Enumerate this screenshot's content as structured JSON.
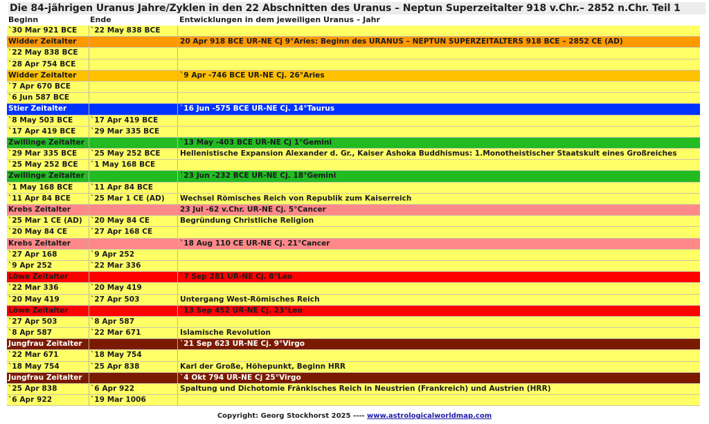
{
  "title": "Die 84-jährigen Uranus Jahre/Zyklen in den 22 Abschnitten des Uranus – Neptun Superzeitalter 918 v.Chr.– 2852 n.Chr.   Teil 1",
  "headers": {
    "begin": "Beginn",
    "end": "Ende",
    "dev": "Entwicklungen in dem jeweiligen Uranus – Jahr"
  },
  "colors": {
    "yellow": "#ffff66",
    "orange": "#ff9900",
    "gold": "#ffc000",
    "blue": "#0033ff",
    "green": "#22bb22",
    "pink": "#ff8888",
    "red": "#ff0000",
    "brown": "#7a1a00"
  },
  "rows": [
    {
      "c1": "`30 Mar 921 BCE",
      "c2": "`22 May 838 BCE",
      "c3": "",
      "bg": "#ffff66",
      "fg": "#1b1b1b"
    },
    {
      "c1": "Widder Zeitalter",
      "c2": "",
      "c3": "20 Apr 918 BCE UR-NE Cj 9°Aries:  Beginn des URANUS – NEPTUN SUPERZEITALTERS   918 BCE – 2852 CE (AD)",
      "bg": "#ff9900",
      "fg": "#1b1b1b"
    },
    {
      "c1": "`22 May 838 BCE",
      "c2": "",
      "c3": "",
      "bg": "#ffff66",
      "fg": "#1b1b1b"
    },
    {
      "c1": "`28 Apr 754 BCE",
      "c2": "",
      "c3": "",
      "bg": "#ffff66",
      "fg": "#1b1b1b"
    },
    {
      "c1": "Widder Zeitalter",
      "c2": "",
      "c3": "`9 Apr -746 BCE      UR-NE Cj. 26°Aries",
      "bg": "#ffc000",
      "fg": "#1b1b1b"
    },
    {
      "c1": "`7 Apr 670 BCE",
      "c2": "",
      "c3": "",
      "bg": "#ffff66",
      "fg": "#1b1b1b"
    },
    {
      "c1": "`6 Jun 587 BCE",
      "c2": "",
      "c3": "",
      "bg": "#ffff66",
      "fg": "#1b1b1b"
    },
    {
      "c1": "Stier Zeitalter",
      "c2": "",
      "c3": "`16 Jun  -575 BCE     UR-NE Cj. 14°Taurus",
      "bg": "#0033ff",
      "fg": "#ffffff"
    },
    {
      "c1": "`8 May 503 BCE",
      "c2": "`17 Apr 419 BCE",
      "c3": "",
      "bg": "#ffff66",
      "fg": "#1b1b1b"
    },
    {
      "c1": "`17 Apr 419 BCE",
      "c2": "`29 Mar 335 BCE",
      "c3": "",
      "bg": "#ffff66",
      "fg": "#1b1b1b"
    },
    {
      "c1": "Zwillinge Zeitalter",
      "c2": "",
      "c3": "`13 May -403 BCE     UR-NE Cj   1°Gemini",
      "bg": "#22bb22",
      "fg": "#1b1b1b"
    },
    {
      "c1": "`29 Mar 335 BCE",
      "c2": "`25 May 252 BCE",
      "c3": "Hellenistische Expansion Alexander d. Gr., Kaiser Ashoka Buddhismus: 1.Monotheistischer Staatskult eines Großreiches",
      "bg": "#ffff66",
      "fg": "#1b1b1b"
    },
    {
      "c1": "`25 May 252 BCE",
      "c2": "`1 May 168 BCE",
      "c3": "",
      "bg": "#ffff66",
      "fg": "#1b1b1b"
    },
    {
      "c1": "Zwillinge Zeitalter",
      "c2": "",
      "c3": "`23 Jun -232 BCE     UR-NE Cj. 18°Gemini",
      "bg": "#22bb22",
      "fg": "#1b1b1b"
    },
    {
      "c1": "`1 May 168 BCE",
      "c2": "`11 Apr 84 BCE",
      "c3": "",
      "bg": "#ffff66",
      "fg": "#1b1b1b"
    },
    {
      "c1": "`11 Apr 84 BCE",
      "c2": "`25 Mar 1 CE (AD)",
      "c3": "Wechsel Römisches Reich von Republik zum Kaiserreich",
      "bg": "#ffff66",
      "fg": "#1b1b1b"
    },
    {
      "c1": "Krebs Zeitalter",
      "c2": "",
      "c3": "23 Jul  -62 v.Chr.     UR-NE Cj.  5°Cancer",
      "bg": "#ff8888",
      "fg": "#1b1b1b"
    },
    {
      "c1": "`25 Mar 1 CE (AD)",
      "c2": "`20 May 84 CE",
      "c3": "Begründung Christliche Religion",
      "bg": "#ffff66",
      "fg": "#1b1b1b"
    },
    {
      "c1": "`20 May 84 CE",
      "c2": "`27 Apr 168 CE",
      "c3": "",
      "bg": "#ffff66",
      "fg": "#1b1b1b"
    },
    {
      "c1": "Krebs Zeitalter",
      "c2": "",
      "c3": "`18 Aug 110 CE      UR-NE Cj.  21°Cancer",
      "bg": "#ff8888",
      "fg": "#1b1b1b"
    },
    {
      "c1": "`27 Apr 168",
      "c2": "`9 Apr 252",
      "c3": "",
      "bg": "#ffff66",
      "fg": "#1b1b1b"
    },
    {
      "c1": "`9 Apr 252",
      "c2": "`22 Mar 336",
      "c3": "",
      "bg": "#ffff66",
      "fg": "#1b1b1b"
    },
    {
      "c1": "Löwe Zeitalter",
      "c2": "",
      "c3": "`7 Sep 281      UR-NE Cj.       8°Leo",
      "bg": "#ff0000",
      "fg": "#1b1b1b"
    },
    {
      "c1": "`22 Mar 336",
      "c2": "`20 May 419",
      "c3": "",
      "bg": "#ffff66",
      "fg": "#1b1b1b"
    },
    {
      "c1": "`20 May 419",
      "c2": "`27 Apr 503",
      "c3": "Untergang West-Römisches Reich",
      "bg": "#ffff66",
      "fg": "#1b1b1b"
    },
    {
      "c1": "Löwe Zeitalter",
      "c2": "",
      "c3": "`13 Sep 452      UR-NE Cj.         23°Leo",
      "bg": "#ff0000",
      "fg": "#1b1b1b"
    },
    {
      "c1": "`27 Apr 503",
      "c2": "`8 Apr 587",
      "c3": "",
      "bg": "#ffff66",
      "fg": "#1b1b1b"
    },
    {
      "c1": "`8 Apr 587",
      "c2": "`22 Mar 671",
      "c3": "Islamische Revolution",
      "bg": "#ffff66",
      "fg": "#1b1b1b"
    },
    {
      "c1": "Jungfrau Zeitalter",
      "c2": "",
      "c3": "`21 Sep 623      UR-NE Cj.        9°Virgo",
      "bg": "#7a1a00",
      "fg": "#ffffff"
    },
    {
      "c1": "`22 Mar 671",
      "c2": "`18 May 754",
      "c3": "",
      "bg": "#ffff66",
      "fg": "#1b1b1b"
    },
    {
      "c1": "`18 May 754",
      "c2": "`25 Apr 838",
      "c3": "Karl der Große, Höhepunkt, Beginn HRR",
      "bg": "#ffff66",
      "fg": "#1b1b1b"
    },
    {
      "c1": "Jungfrau Zeitalter",
      "c2": "",
      "c3": "`4 Okt 794      UR-NE Cj      25°Virgo",
      "bg": "#7a1a00",
      "fg": "#ffffff"
    },
    {
      "c1": "`25 Apr 838",
      "c2": "`6 Apr 922",
      "c3": "Spaltung und Dichotomie Fränkisches Reich in Neustrien (Frankreich) und Austrien (HRR)",
      "bg": "#ffff66",
      "fg": "#1b1b1b"
    },
    {
      "c1": "`6 Apr 922",
      "c2": "`19 Mar 1006",
      "c3": "",
      "bg": "#ffff66",
      "fg": "#1b1b1b"
    }
  ],
  "footer": {
    "copyright": "Copyright: Georg Stockhorst 2025 ----  ",
    "link": "www.astrologicalworldmap.com"
  }
}
